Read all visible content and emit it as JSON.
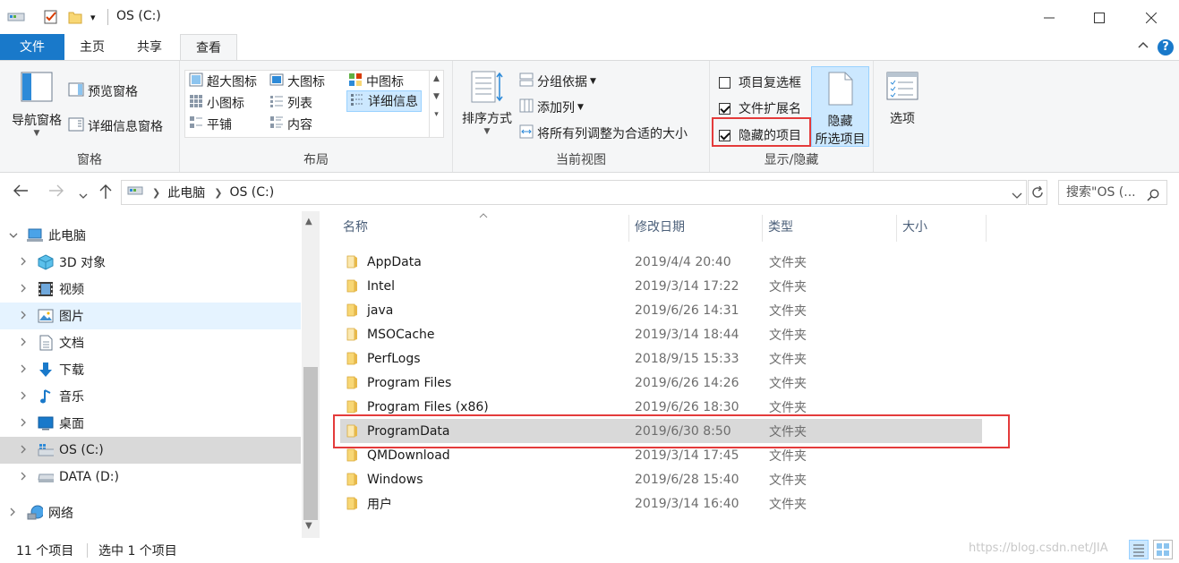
{
  "window": {
    "title": "OS (C:)",
    "qa_dropdown": "▾"
  },
  "tabs": [
    {
      "label": "文件"
    },
    {
      "label": "主页"
    },
    {
      "label": "共享"
    },
    {
      "label": "查看"
    }
  ],
  "ribbon": {
    "panes": {
      "nav_pane": "导航窗格",
      "preview_pane": "预览窗格",
      "details_pane": "详细信息窗格",
      "group_label": "窗格"
    },
    "layout": {
      "extra_large_icons": "超大图标",
      "large_icons": "大图标",
      "medium_icons": "中图标",
      "small_icons": "小图标",
      "list": "列表",
      "details": "详细信息",
      "tiles": "平铺",
      "content": "内容",
      "group_label": "布局"
    },
    "current_view": {
      "sort_by": "排序方式",
      "group_by": "分组依据",
      "add_columns": "添加列",
      "size_all_columns": "将所有列调整为合适的大小",
      "group_label": "当前视图"
    },
    "show_hide": {
      "item_checkboxes": "项目复选框",
      "item_checkboxes_checked": false,
      "file_extensions": "文件扩展名",
      "file_extensions_checked": true,
      "hidden_items": "隐藏的项目",
      "hidden_items_checked": true,
      "hide_selected_line1": "隐藏",
      "hide_selected_line2": "所选项目",
      "group_label": "显示/隐藏"
    },
    "options": "选项"
  },
  "address": {
    "crumbs": [
      "此电脑",
      "OS (C:)"
    ],
    "search_placeholder": "搜索\"OS (..."
  },
  "nav_tree": [
    {
      "label": "此电脑",
      "icon": "computer-icon",
      "expanded": true
    },
    {
      "label": "3D 对象",
      "icon": "cube-3d-icon"
    },
    {
      "label": "视频",
      "icon": "video-icon"
    },
    {
      "label": "图片",
      "icon": "pictures-icon"
    },
    {
      "label": "文档",
      "icon": "documents-icon"
    },
    {
      "label": "下载",
      "icon": "download-icon"
    },
    {
      "label": "音乐",
      "icon": "music-icon"
    },
    {
      "label": "桌面",
      "icon": "desktop-icon"
    },
    {
      "label": "OS (C:)",
      "icon": "windows-drive-icon"
    },
    {
      "label": "DATA (D:)",
      "icon": "drive-icon"
    },
    {
      "label": "网络",
      "icon": "network-icon"
    }
  ],
  "columns": {
    "name": "名称",
    "date": "修改日期",
    "type": "类型",
    "size": "大小"
  },
  "files": [
    {
      "name": "AppData",
      "date": "2019/4/4 20:40",
      "type": "文件夹",
      "hidden": true
    },
    {
      "name": "Intel",
      "date": "2019/3/14 17:22",
      "type": "文件夹"
    },
    {
      "name": "java",
      "date": "2019/6/26 14:31",
      "type": "文件夹"
    },
    {
      "name": "MSOCache",
      "date": "2019/3/14 18:44",
      "type": "文件夹",
      "hidden": true
    },
    {
      "name": "PerfLogs",
      "date": "2018/9/15 15:33",
      "type": "文件夹"
    },
    {
      "name": "Program Files",
      "date": "2019/6/26 14:26",
      "type": "文件夹"
    },
    {
      "name": "Program Files (x86)",
      "date": "2019/6/26 18:30",
      "type": "文件夹"
    },
    {
      "name": "ProgramData",
      "date": "2019/6/30 8:50",
      "type": "文件夹",
      "hidden": true,
      "selected": true
    },
    {
      "name": "QMDownload",
      "date": "2019/3/14 17:45",
      "type": "文件夹"
    },
    {
      "name": "Windows",
      "date": "2019/6/28 15:40",
      "type": "文件夹"
    },
    {
      "name": "用户",
      "date": "2019/3/14 16:40",
      "type": "文件夹"
    }
  ],
  "status": {
    "count": "11 个项目",
    "selected": "选中 1 个项目",
    "watermark": "https://blog.csdn.net/JIA"
  },
  "colors": {
    "file_tab": "#1979ca",
    "folder": "#f8d775",
    "folder_hidden": "#fbe8b0",
    "highlight_red": "#e43b3b",
    "selection": "#d9d9d9"
  }
}
